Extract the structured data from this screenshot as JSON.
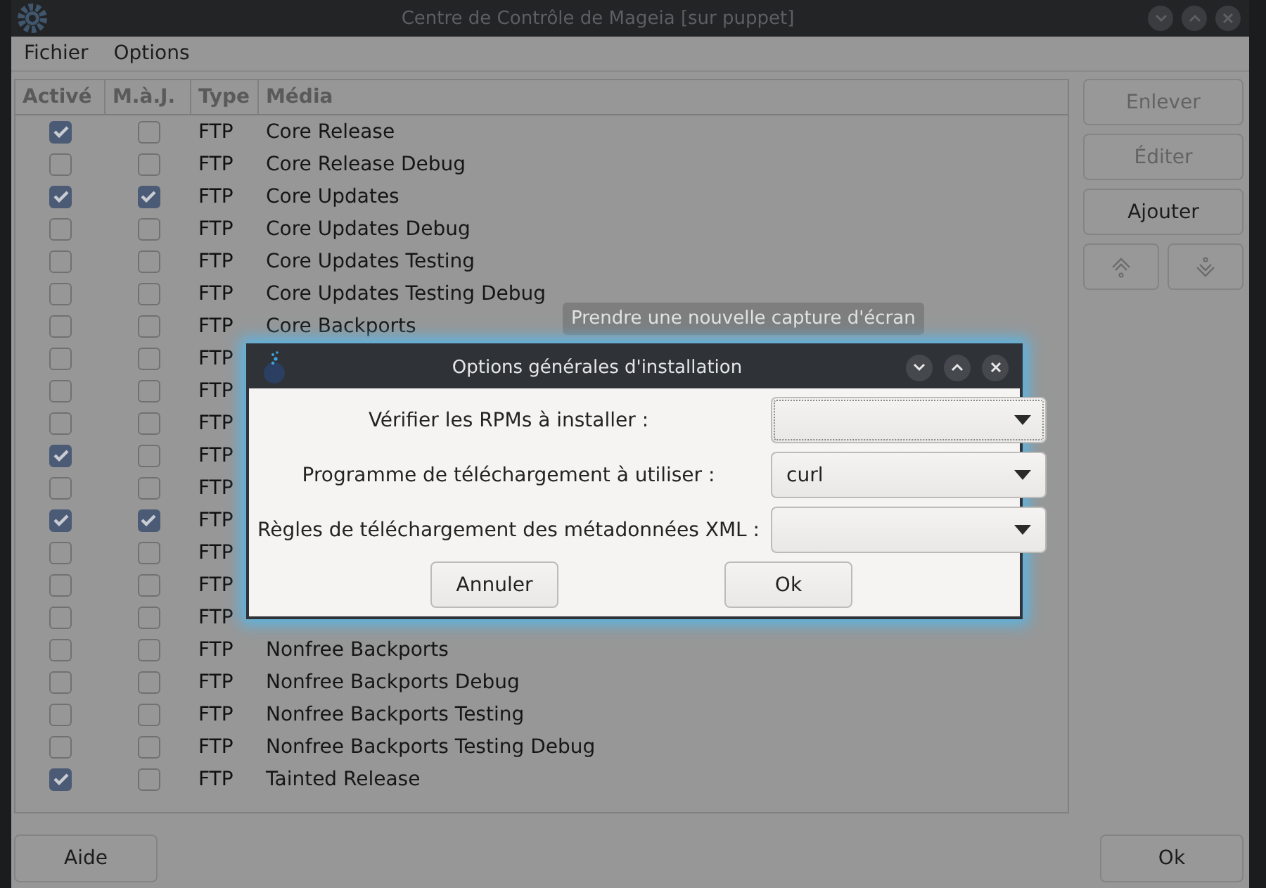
{
  "window": {
    "title": "Centre de Contrôle de Mageia [sur puppet]"
  },
  "menu": [
    "Fichier",
    "Options"
  ],
  "table": {
    "columns": [
      "Activé",
      "M.à.J.",
      "Type",
      "Média"
    ],
    "rows": [
      {
        "enabled": true,
        "update": false,
        "type": "FTP",
        "media": "Core Release"
      },
      {
        "enabled": false,
        "update": false,
        "type": "FTP",
        "media": "Core Release Debug"
      },
      {
        "enabled": true,
        "update": true,
        "type": "FTP",
        "media": "Core Updates"
      },
      {
        "enabled": false,
        "update": false,
        "type": "FTP",
        "media": "Core Updates Debug"
      },
      {
        "enabled": false,
        "update": false,
        "type": "FTP",
        "media": "Core Updates Testing"
      },
      {
        "enabled": false,
        "update": false,
        "type": "FTP",
        "media": "Core Updates Testing Debug"
      },
      {
        "enabled": false,
        "update": false,
        "type": "FTP",
        "media": "Core Backports"
      },
      {
        "enabled": false,
        "update": false,
        "type": "FTP"
      },
      {
        "enabled": false,
        "update": false,
        "type": "FTP"
      },
      {
        "enabled": false,
        "update": false,
        "type": "FTP"
      },
      {
        "enabled": true,
        "update": false,
        "type": "FTP"
      },
      {
        "enabled": false,
        "update": false,
        "type": "FTP"
      },
      {
        "enabled": true,
        "update": true,
        "type": "FTP"
      },
      {
        "enabled": false,
        "update": false,
        "type": "FTP"
      },
      {
        "enabled": false,
        "update": false,
        "type": "FTP"
      },
      {
        "enabled": false,
        "update": false,
        "type": "FTP"
      },
      {
        "enabled": false,
        "update": false,
        "type": "FTP",
        "media": "Nonfree Backports"
      },
      {
        "enabled": false,
        "update": false,
        "type": "FTP",
        "media": "Nonfree Backports Debug"
      },
      {
        "enabled": false,
        "update": false,
        "type": "FTP",
        "media": "Nonfree Backports Testing"
      },
      {
        "enabled": false,
        "update": false,
        "type": "FTP",
        "media": "Nonfree Backports Testing Debug"
      },
      {
        "enabled": true,
        "update": false,
        "type": "FTP",
        "media": "Tainted Release"
      }
    ]
  },
  "side_buttons": [
    {
      "label": "Enlever",
      "disabled": true
    },
    {
      "label": "Éditer",
      "disabled": true
    },
    {
      "label": "Ajouter",
      "disabled": false
    }
  ],
  "tooltip": "Prendre une nouvelle capture d'écran",
  "dialog": {
    "title": "Options générales d'installation",
    "fields": [
      {
        "label": "Vérifier les RPMs à installer :",
        "focused": true
      },
      {
        "label": "Programme de téléchargement à utiliser :",
        "value": "curl",
        "focused": false
      },
      {
        "label": "Règles de téléchargement des métadonnées XML :",
        "focused": false
      }
    ],
    "buttons": [
      "Annuler",
      "Ok"
    ]
  },
  "footer": {
    "help": "Aide",
    "ok": "Ok"
  }
}
